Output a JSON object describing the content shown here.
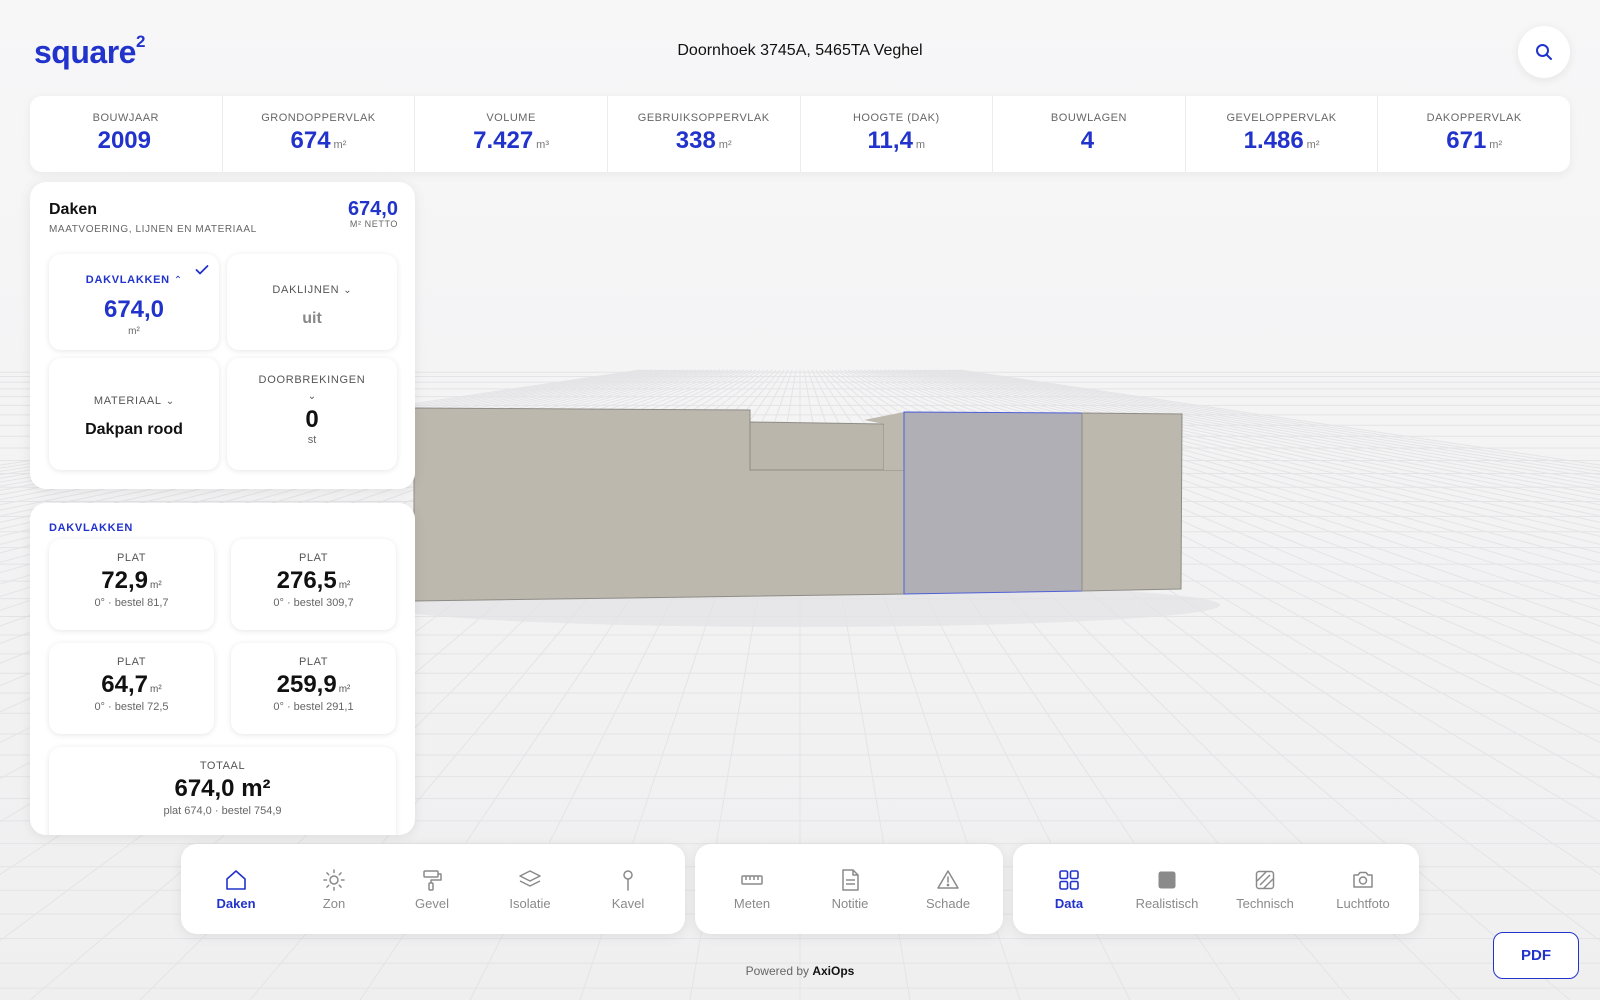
{
  "header": {
    "logo_text": "square",
    "logo_sup": "2",
    "address": "Doornhoek 3745A, 5465TA Veghel"
  },
  "stats": [
    {
      "label": "BOUWJAAR",
      "value": "2009",
      "unit": ""
    },
    {
      "label": "GRONDOPPERVLAK",
      "value": "674",
      "unit": "m²"
    },
    {
      "label": "VOLUME",
      "value": "7.427",
      "unit": "m³"
    },
    {
      "label": "GEBRUIKSOPPERVLAK",
      "value": "338",
      "unit": "m²"
    },
    {
      "label": "HOOGTE (DAK)",
      "value": "11,4",
      "unit": "m"
    },
    {
      "label": "BOUWLAGEN",
      "value": "4",
      "unit": ""
    },
    {
      "label": "GEVELOPPERVLAK",
      "value": "1.486",
      "unit": "m²"
    },
    {
      "label": "DAKOPPERVLAK",
      "value": "671",
      "unit": "m²"
    }
  ],
  "daken": {
    "title": "Daken",
    "subtitle": "MAATVOERING, LIJNEN EN MATERIAAL",
    "total_value": "674,0",
    "total_label": "M² NETTO",
    "dakvlakken": {
      "label": "DAKVLAKKEN",
      "value": "674,0",
      "unit": "m²"
    },
    "daklijnen": {
      "label": "DAKLIJNEN",
      "value": "uit"
    },
    "materiaal": {
      "label": "MATERIAAL",
      "value": "Dakpan rood"
    },
    "doorbrekingen": {
      "label": "DOORBREKINGEN",
      "value": "0",
      "unit": "st"
    }
  },
  "list": {
    "heading": "DAKVLAKKEN",
    "faces": [
      {
        "type": "PLAT",
        "area": "72,9",
        "unit": "m²",
        "meta": "0° · bestel 81,7"
      },
      {
        "type": "PLAT",
        "area": "276,5",
        "unit": "m²",
        "meta": "0° · bestel 309,7"
      },
      {
        "type": "PLAT",
        "area": "64,7",
        "unit": "m²",
        "meta": "0° · bestel 72,5"
      },
      {
        "type": "PLAT",
        "area": "259,9",
        "unit": "m²",
        "meta": "0° · bestel 291,1"
      }
    ],
    "total": {
      "label": "TOTAAL",
      "value": "674,0 m²",
      "meta": "plat 674,0 · bestel 754,9"
    }
  },
  "toolbar1": [
    {
      "label": "Daken",
      "icon": "home-icon",
      "active": true
    },
    {
      "label": "Zon",
      "icon": "sun-icon",
      "active": false
    },
    {
      "label": "Gevel",
      "icon": "paint-roller-icon",
      "active": false
    },
    {
      "label": "Isolatie",
      "icon": "layers-icon",
      "active": false
    },
    {
      "label": "Kavel",
      "icon": "map-pin-icon",
      "active": false
    }
  ],
  "toolbar2": [
    {
      "label": "Meten",
      "icon": "ruler-icon",
      "active": false
    },
    {
      "label": "Notitie",
      "icon": "note-icon",
      "active": false
    },
    {
      "label": "Schade",
      "icon": "warning-icon",
      "active": false
    }
  ],
  "toolbar3": [
    {
      "label": "Data",
      "icon": "grid-icon",
      "active": true
    },
    {
      "label": "Realistisch",
      "icon": "square-icon",
      "active": false
    },
    {
      "label": "Technisch",
      "icon": "hatched-square-icon",
      "active": false
    },
    {
      "label": "Luchtfoto",
      "icon": "camera-icon",
      "active": false
    }
  ],
  "footer": {
    "powered_prefix": "Powered by",
    "powered_brand": "AxiOps",
    "pdf_label": "PDF"
  },
  "colors": {
    "accent": "#2233cc",
    "building": "#bcb8ae",
    "selected_face": "#b0afb6"
  }
}
